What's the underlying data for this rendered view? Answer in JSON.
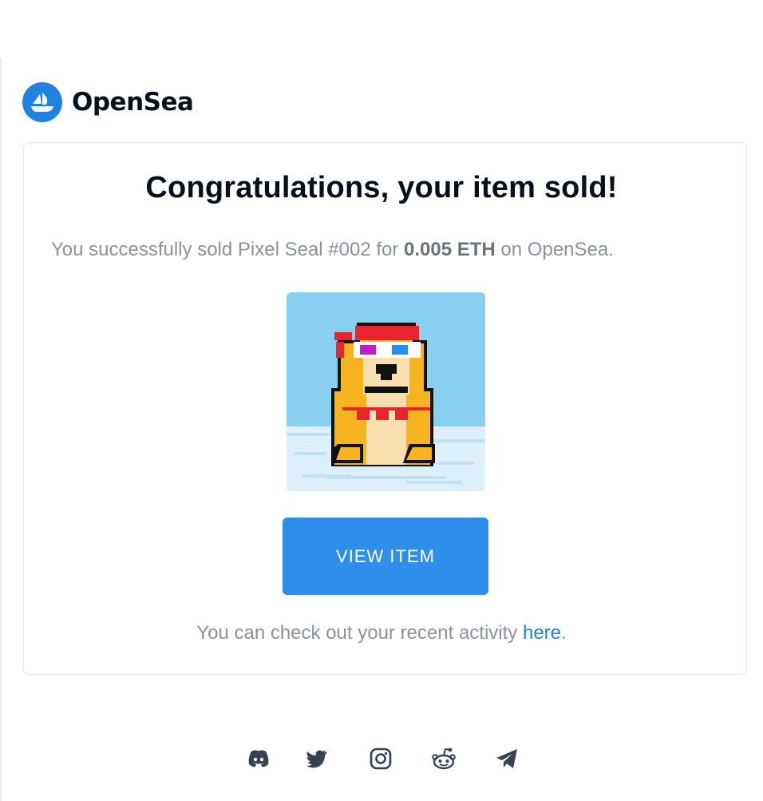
{
  "brand": {
    "name": "OpenSea",
    "logo_icon": "opensea-boat-icon",
    "color": "#2081e2"
  },
  "card": {
    "title": "Congratulations, your item sold!",
    "sold_prefix": "You successfully sold Pixel Seal #002 for ",
    "price": "0.005 ETH",
    "sold_suffix": " on OpenSea.",
    "image_icon": "pixel-seal-nft-image",
    "button_label": "VIEW ITEM",
    "button_color": "#2f8eea",
    "activity_prefix": "You can check out your recent activity ",
    "activity_link": "here",
    "activity_suffix": "."
  },
  "social": [
    "discord-icon",
    "twitter-icon",
    "instagram-icon",
    "reddit-icon",
    "telegram-icon"
  ]
}
